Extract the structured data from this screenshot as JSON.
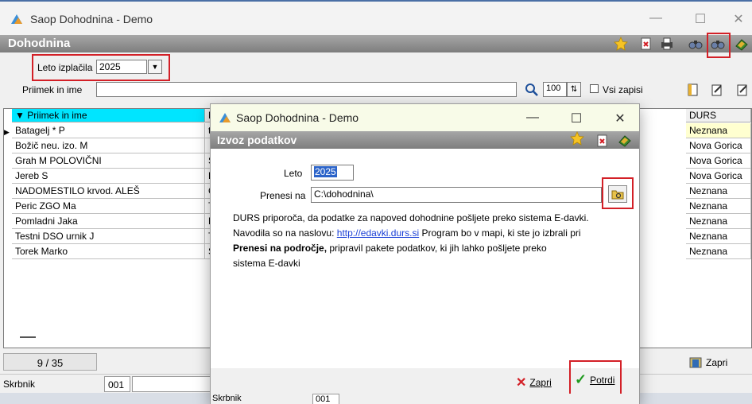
{
  "window": {
    "title": "Saop Dohodnina - Demo",
    "section": "Dohodnina",
    "controls": {
      "minimize": "—",
      "maximize": "☐",
      "close": "✕"
    }
  },
  "filters": {
    "leto_label": "Leto izplačila",
    "leto_value": "2025",
    "search_label": "Priimek in ime",
    "search_value": "",
    "page_size": "100",
    "vsi_zapisi_label": "Vsi zapisi"
  },
  "grid": {
    "columns": [
      "Priimek in ime",
      "N",
      "DURS"
    ],
    "rows": [
      {
        "name": "Batagelj * P",
        "n": "te",
        "durs": "Neznana"
      },
      {
        "name": "Božič neu. izo. M",
        "n": "",
        "durs": "Nova Gorica"
      },
      {
        "name": "Grah M POLOVIČNI",
        "n": "Š",
        "durs": "Nova Gorica"
      },
      {
        "name": "Jereb S",
        "n": "L",
        "durs": "Nova Gorica"
      },
      {
        "name": "NADOMESTILO krvod. ALEŠ",
        "n": "C",
        "durs": "Neznana"
      },
      {
        "name": "Peric ZGO Ma",
        "n": "T",
        "durs": "Neznana"
      },
      {
        "name": "Pomladni Jaka",
        "n": "N",
        "durs": "Neznana"
      },
      {
        "name": "Testni DSO urnik J",
        "n": "T",
        "durs": "Neznana"
      },
      {
        "name": "Torek Marko",
        "n": "S",
        "durs": "Neznana"
      }
    ]
  },
  "counter": "9 / 35",
  "zapri_main": "Zapri",
  "status": {
    "label": "Skrbnik",
    "code": "001"
  },
  "dialog": {
    "title": "Saop Dohodnina - Demo",
    "section": "Izvoz podatkov",
    "leto_label": "Leto",
    "leto_value": "2025",
    "prenesi_label": "Prenesi na",
    "prenesi_value": "C:\\dohodnina\\",
    "info_line1": "DURS priporoča, da podatke za napoved dohodnine pošljete preko sistema E-davki.",
    "info_line2_prefix": "Navodila so na naslovu:",
    "info_link": "http://edavki.durs.si",
    "info_line2_suffix": " Program bo v mapi, ki ste jo izbrali pri",
    "info_bold": "Prenesi na področje,",
    "info_line3_suffix": " pripravil pakete podatkov, ki jih lahko pošljete preko",
    "info_line4": "sistema E-davki",
    "btn_zapri": "Zapri",
    "btn_potrdi": "Potrdi",
    "status_label": "Skrbnik",
    "status_code": "001"
  }
}
